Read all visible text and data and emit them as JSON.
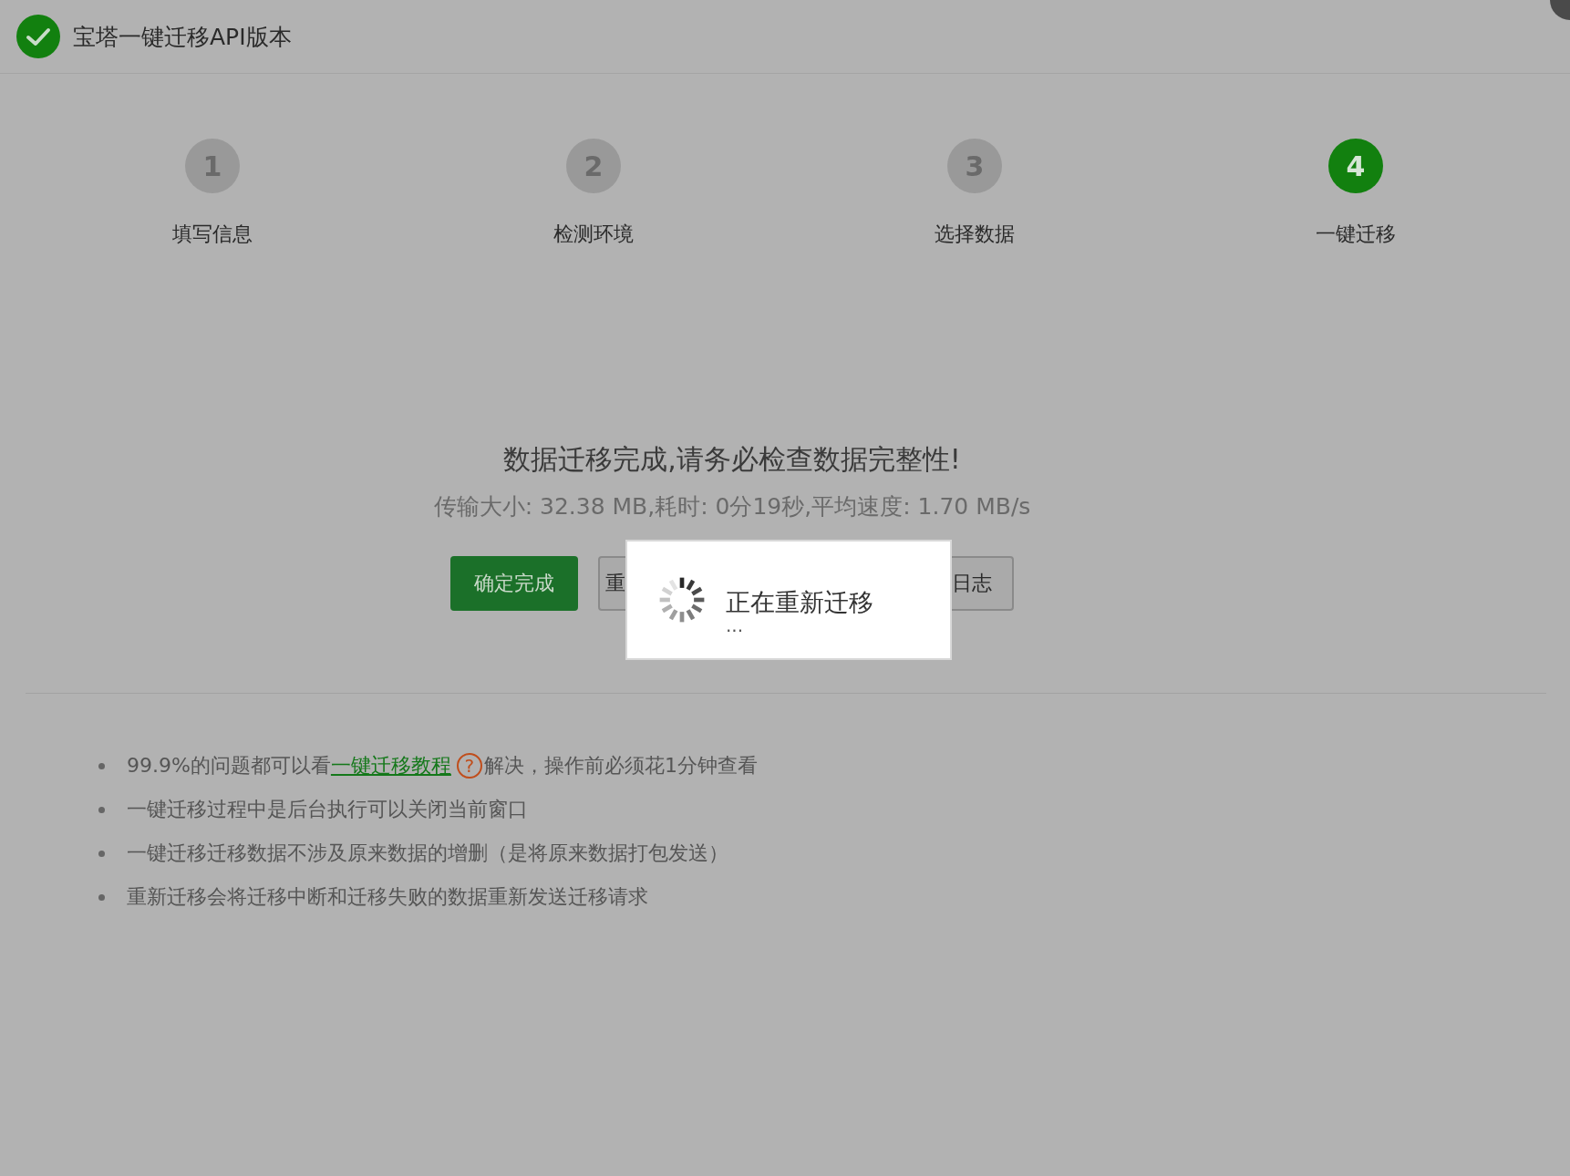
{
  "window": {
    "title": "宝塔一键迁移API版本"
  },
  "steps": [
    {
      "number": "1",
      "label": "填写信息",
      "selected": false
    },
    {
      "number": "2",
      "label": "检测环境",
      "selected": false
    },
    {
      "number": "3",
      "label": "选择数据",
      "selected": false
    },
    {
      "number": "4",
      "label": "一键迁移",
      "selected": true
    }
  ],
  "result": {
    "heading": "数据迁移完成,请务必检查数据完整性!",
    "summary": "传输大小: 32.38 MB,耗时: 0分19秒,平均速度: 1.70 MB/s"
  },
  "buttons": [
    {
      "label": "确定完成",
      "kind": "primary"
    },
    {
      "label": "重",
      "kind": "outline-left"
    },
    {
      "label": "日志",
      "kind": "outline-right"
    }
  ],
  "loading": {
    "message": "正在重新迁移",
    "ellipsis": "..."
  },
  "notes": [
    {
      "kind": "link",
      "before": "99.9%的问题都可以看",
      "link": "一键迁移教程",
      "help": "?",
      "after": "解决，操作前必须花1分钟查看"
    },
    {
      "kind": "plain",
      "text": "一键迁移过程中是后台执行可以关闭当前窗口"
    },
    {
      "kind": "plain",
      "text": "一键迁移迁移数据不涉及原来数据的增删（是将原来数据打包发送）"
    },
    {
      "kind": "plain",
      "text": "重新迁移会将迁移中断和迁移失败的数据重新发送迁移请求"
    }
  ]
}
